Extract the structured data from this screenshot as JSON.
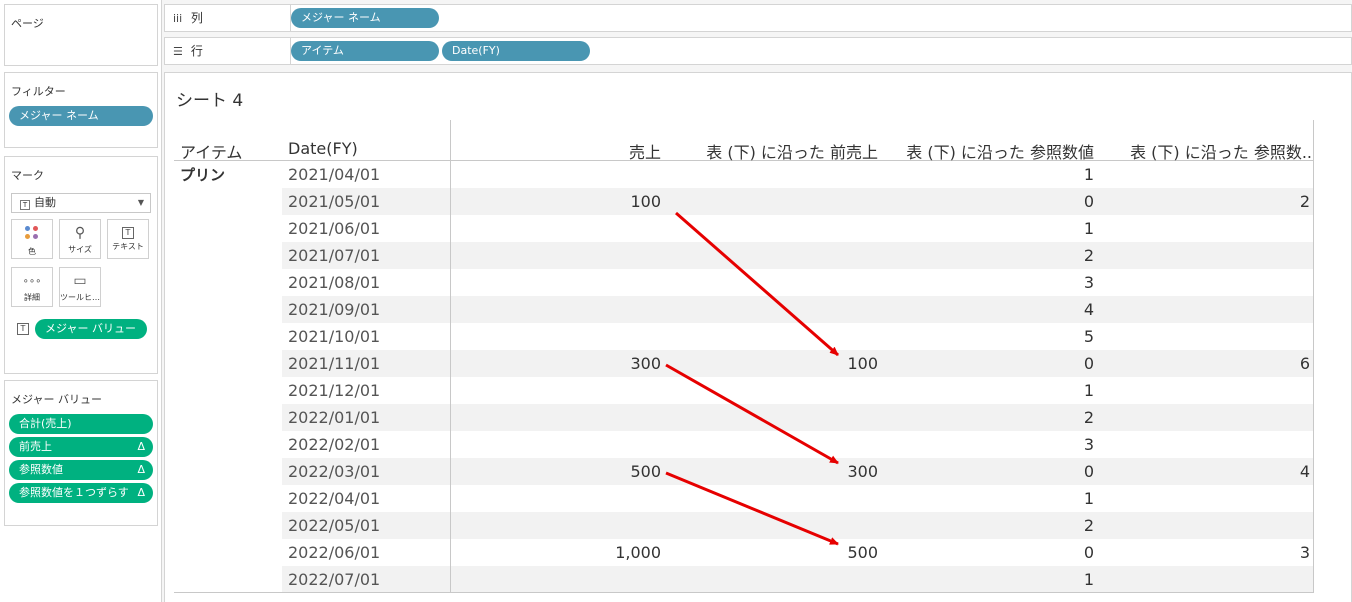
{
  "left_panels": {
    "pages": {
      "title": "ページ"
    },
    "filters": {
      "title": "フィルター",
      "pill": "メジャー ネーム"
    },
    "marks": {
      "title": "マーク",
      "type_dropdown": "自動",
      "buttons": {
        "color": "色",
        "size": "サイズ",
        "text": "テキスト",
        "detail": "詳細",
        "tooltip": "ツールヒ…"
      },
      "text_pill": "メジャー バリュー"
    },
    "measure_values": {
      "title": "メジャー バリュー",
      "pills": [
        {
          "label": "合計(売上)",
          "delta": ""
        },
        {
          "label": "前売上",
          "delta": "Δ"
        },
        {
          "label": "参照数値",
          "delta": "Δ"
        },
        {
          "label": "参照数値を１つずらす",
          "delta": "Δ"
        }
      ]
    }
  },
  "shelves": {
    "columns": {
      "label": "列",
      "icon": "columns-icon",
      "pills": [
        "メジャー ネーム"
      ]
    },
    "rows": {
      "label": "行",
      "icon": "rows-icon",
      "pills": [
        "アイテム",
        "Date(FY)"
      ]
    }
  },
  "view": {
    "sheet_title": "シート 4",
    "headers": {
      "item": "アイテム",
      "date": "Date(FY)",
      "sales": "売上",
      "prev_sales": "表 (下) に沿った 前売上",
      "ref_value": "表 (下) に沿った 参照数値",
      "ref_shift": "表 (下) に沿った 参照数.."
    },
    "item_label": "プリン",
    "rows": [
      {
        "date": "2021/04/01",
        "sales": "",
        "prev": "",
        "ref": "1",
        "shift": ""
      },
      {
        "date": "2021/05/01",
        "sales": "100",
        "prev": "",
        "ref": "0",
        "shift": "2"
      },
      {
        "date": "2021/06/01",
        "sales": "",
        "prev": "",
        "ref": "1",
        "shift": ""
      },
      {
        "date": "2021/07/01",
        "sales": "",
        "prev": "",
        "ref": "2",
        "shift": ""
      },
      {
        "date": "2021/08/01",
        "sales": "",
        "prev": "",
        "ref": "3",
        "shift": ""
      },
      {
        "date": "2021/09/01",
        "sales": "",
        "prev": "",
        "ref": "4",
        "shift": ""
      },
      {
        "date": "2021/10/01",
        "sales": "",
        "prev": "",
        "ref": "5",
        "shift": ""
      },
      {
        "date": "2021/11/01",
        "sales": "300",
        "prev": "100",
        "ref": "0",
        "shift": "6"
      },
      {
        "date": "2021/12/01",
        "sales": "",
        "prev": "",
        "ref": "1",
        "shift": ""
      },
      {
        "date": "2022/01/01",
        "sales": "",
        "prev": "",
        "ref": "2",
        "shift": ""
      },
      {
        "date": "2022/02/01",
        "sales": "",
        "prev": "",
        "ref": "3",
        "shift": ""
      },
      {
        "date": "2022/03/01",
        "sales": "500",
        "prev": "300",
        "ref": "0",
        "shift": "4"
      },
      {
        "date": "2022/04/01",
        "sales": "",
        "prev": "",
        "ref": "1",
        "shift": ""
      },
      {
        "date": "2022/05/01",
        "sales": "",
        "prev": "",
        "ref": "2",
        "shift": ""
      },
      {
        "date": "2022/06/01",
        "sales": "1,000",
        "prev": "500",
        "ref": "0",
        "shift": "3"
      },
      {
        "date": "2022/07/01",
        "sales": "",
        "prev": "",
        "ref": "1",
        "shift": ""
      }
    ]
  },
  "colors": {
    "blue_pill": "#4996b2",
    "green_pill": "#00b180",
    "band": "#f2f2f2",
    "arrow": "#e60000"
  },
  "annotations": {
    "arrows": [
      {
        "from_row": 1,
        "to_row": 7,
        "meaning": "sales 100 becomes prev sales"
      },
      {
        "from_row": 7,
        "to_row": 11,
        "meaning": "sales 300 becomes prev sales"
      },
      {
        "from_row": 11,
        "to_row": 14,
        "meaning": "sales 500 becomes prev sales"
      }
    ]
  }
}
